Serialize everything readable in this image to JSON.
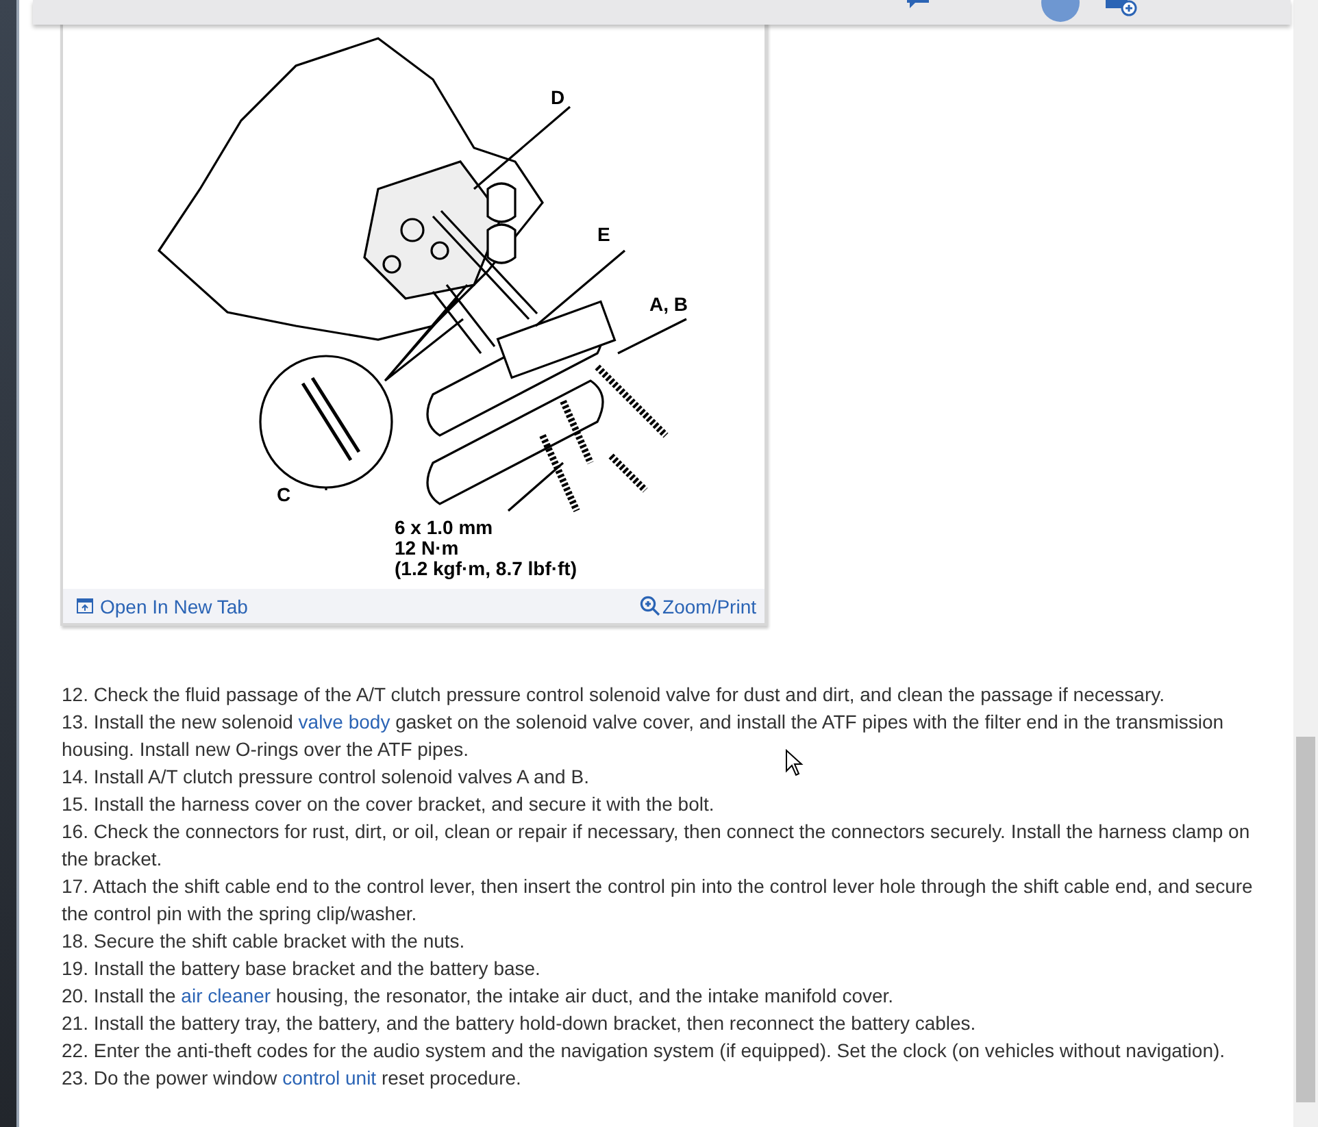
{
  "figure": {
    "callouts": [
      "D",
      "E",
      "A, B",
      "C",
      "6 x 1.0 mm",
      "12 N·m",
      "(1.2 kgf·m, 8.7 lbf·ft)"
    ],
    "actions": [
      {
        "kind": "open",
        "label": "Open In New Tab"
      },
      {
        "kind": "zoom",
        "label": "Zoom/Print"
      }
    ]
  },
  "steps": [
    {
      "segments": [
        {
          "kind": "text",
          "text": "12. Check the fluid passage of the A/T clutch pressure control solenoid valve for dust and dirt, and clean the passage if necessary."
        }
      ]
    },
    {
      "segments": [
        {
          "kind": "text",
          "text": "13. Install the new solenoid "
        },
        {
          "kind": "link",
          "text": "valve body"
        },
        {
          "kind": "text",
          "text": " gasket on the solenoid valve cover, and install the ATF pipes with the filter end in the transmission housing. Install new O-rings over the ATF pipes."
        }
      ]
    },
    {
      "segments": [
        {
          "kind": "text",
          "text": "14. Install A/T clutch pressure control solenoid valves A and B."
        }
      ]
    },
    {
      "segments": [
        {
          "kind": "text",
          "text": "15. Install the harness cover on the cover bracket, and secure it with the bolt."
        }
      ]
    },
    {
      "segments": [
        {
          "kind": "text",
          "text": "16. Check the connectors for rust, dirt, or oil, clean or repair if necessary, then connect the connectors securely. Install the harness clamp on the bracket."
        }
      ]
    },
    {
      "segments": [
        {
          "kind": "text",
          "text": "17. Attach the shift cable end to the control lever, then insert the control pin into the control lever hole through the shift cable end, and secure the control pin with the spring clip/washer."
        }
      ]
    },
    {
      "segments": [
        {
          "kind": "text",
          "text": "18. Secure the shift cable bracket with the nuts."
        }
      ]
    },
    {
      "segments": [
        {
          "kind": "text",
          "text": "19. Install the battery base bracket and the battery base."
        }
      ]
    },
    {
      "segments": [
        {
          "kind": "text",
          "text": "20. Install the "
        },
        {
          "kind": "link",
          "text": "air cleaner"
        },
        {
          "kind": "text",
          "text": " housing, the resonator, the intake air duct, and the intake manifold cover."
        }
      ]
    },
    {
      "segments": [
        {
          "kind": "text",
          "text": "21. Install the battery tray, the battery, and the battery hold-down bracket, then reconnect the battery cables."
        }
      ]
    },
    {
      "segments": [
        {
          "kind": "text",
          "text": "22. Enter the anti-theft codes for the audio system and the navigation system (if equipped). Set the clock (on vehicles without navigation)."
        }
      ]
    },
    {
      "segments": [
        {
          "kind": "text",
          "text": "23. Do the power window "
        },
        {
          "kind": "link",
          "text": "control unit"
        },
        {
          "kind": "text",
          "text": " reset procedure."
        }
      ]
    }
  ]
}
